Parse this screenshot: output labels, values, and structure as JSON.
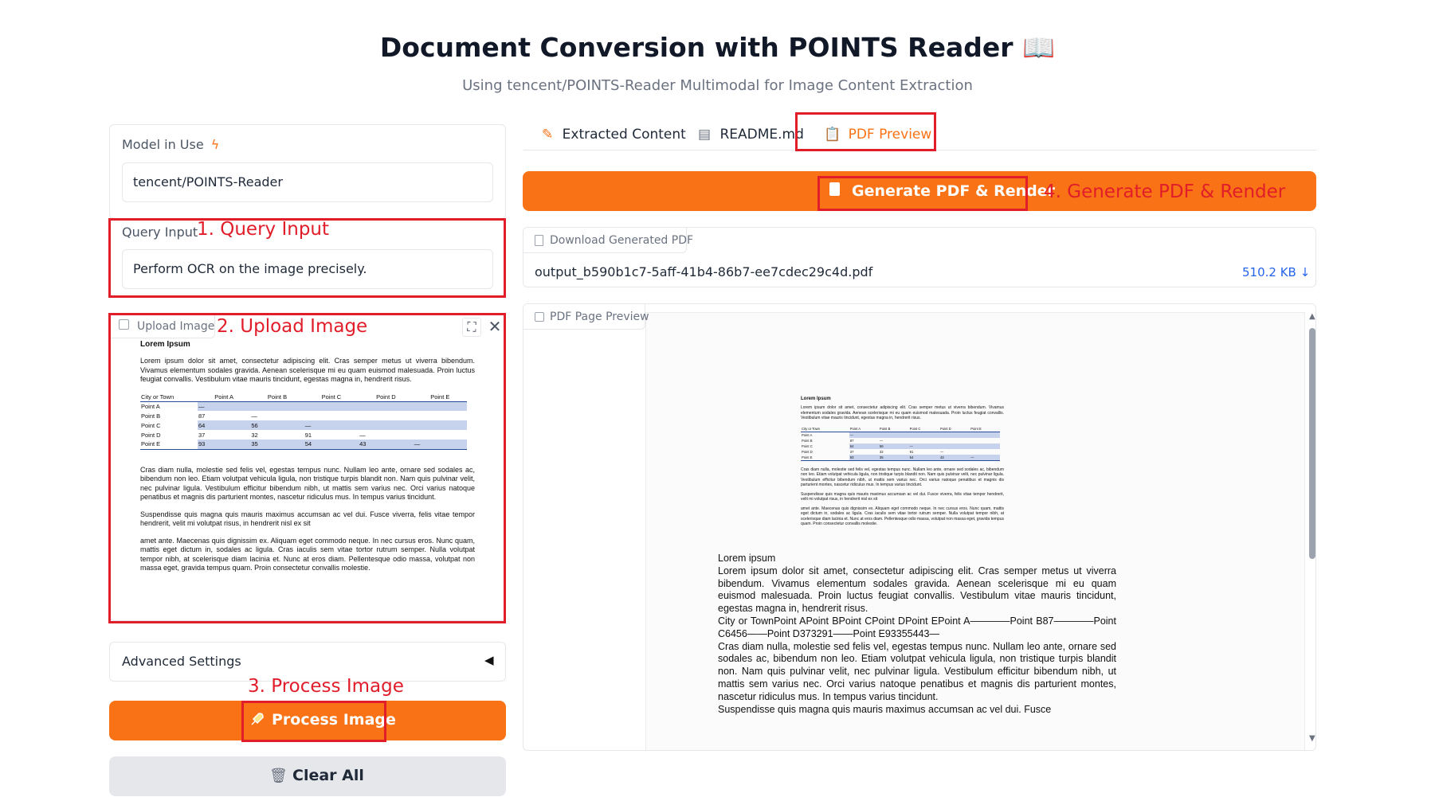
{
  "header": {
    "title": "Document Conversion with POINTS Reader 📖",
    "subtitle": "Using tencent/POINTS-Reader Multimodal for Image Content Extraction"
  },
  "left": {
    "model_label": "Model in Use",
    "model_value": "tencent/POINTS-Reader",
    "query_label": "Query Input",
    "query_value": "Perform OCR on the image precisely.",
    "upload_label": "Upload Image",
    "advanced_label": "Advanced Settings",
    "process_label": "Process Image",
    "clear_label": "Clear All"
  },
  "annotations": {
    "a1": "1. Query Input",
    "a2": "2. Upload Image",
    "a3": "3. Process Image",
    "a4": "4. Generate PDF & Render"
  },
  "tabs": [
    {
      "label": "Extracted Content"
    },
    {
      "label": "README.md"
    },
    {
      "label": "PDF Preview"
    }
  ],
  "right": {
    "generate_label": "Generate PDF & Render",
    "download_label": "Download Generated PDF",
    "file_name": "output_b590b1c7-5aff-41b4-86b7-ee7cdec29c4d.pdf",
    "file_size": "510.2 KB",
    "preview_label": "PDF Page Preview"
  },
  "doc": {
    "heading": "Lorem Ipsum",
    "p1": "Lorem ipsum dolor sit amet, consectetur adipiscing elit. Cras semper metus ut viverra bibendum. Vivamus elementum sodales gravida. Aenean scelerisque mi eu quam euismod malesuada. Proin luctus feugiat convallis. Vestibulum vitae mauris tincidunt, egestas magna in, hendrerit risus.",
    "table_headers": [
      "City or Town",
      "Point A",
      "Point B",
      "Point C",
      "Point D",
      "Point E"
    ],
    "table_rows": [
      [
        "Point A",
        "—",
        "",
        "",
        "",
        ""
      ],
      [
        "Point B",
        "87",
        "—",
        "",
        "",
        ""
      ],
      [
        "Point C",
        "64",
        "56",
        "—",
        "",
        ""
      ],
      [
        "Point D",
        "37",
        "32",
        "91",
        "—",
        ""
      ],
      [
        "Point E",
        "93",
        "35",
        "54",
        "43",
        "—"
      ]
    ],
    "p2": "Cras diam nulla, molestie sed felis vel, egestas tempus nunc. Nullam leo ante, ornare sed sodales ac, bibendum non leo. Etiam volutpat vehicula ligula, non tristique turpis blandit non. Nam quis pulvinar velit, nec pulvinar ligula. Vestibulum efficitur bibendum nibh, ut mattis sem varius nec. Orci varius natoque penatibus et magnis dis parturient montes, nascetur ridiculus mus. In tempus varius tincidunt.",
    "p3": "Suspendisse quis magna quis mauris maximus accumsan ac vel dui. Fusce viverra, felis vitae tempor hendrerit, velit mi volutpat risus, in hendrerit nisl ex sit",
    "p4": "amet ante. Maecenas quis dignissim ex. Aliquam eget commodo neque. In nec cursus eros. Nunc quam, mattis eget dictum in, sodales ac ligula. Cras iaculis sem vitae tortor rutrum semper. Nulla volutpat tempor nibh, at scelerisque diam lacinia et. Nunc at eros diam. Pellentesque odio massa, volutpat non massa eget, gravida tempus quam. Proin consectetur convallis molestie."
  },
  "extracted": {
    "heading": "Lorem ipsum",
    "p1": "Lorem ipsum dolor sit amet, consectetur adipiscing elit. Cras semper metus ut viverra bibendum. Vivamus elementum sodales gravida. Aenean scelerisque mi eu quam euismod malesuada. Proin luctus feugiat convallis. Vestibulum vitae mauris tincidunt, egestas magna in, hendrerit risus.",
    "p2": "City or TownPoint APoint BPoint CPoint DPoint EPoint A————Point B87————Point C6456——Point D373291——Point E93355443—",
    "p3": "Cras diam nulla, molestie sed felis vel, egestas tempus nunc. Nullam leo ante, ornare sed sodales ac, bibendum non leo. Etiam volutpat vehicula ligula, non tristique turpis blandit non. Nam quis pulvinar velit, nec pulvinar ligula. Vestibulum efficitur bibendum nibh, ut mattis sem varius nec. Orci varius natoque penatibus et magnis dis parturient montes, nascetur ridiculus mus. In tempus varius tincidunt.",
    "p4": "Suspendisse quis magna quis mauris maximus accumsan ac vel dui. Fusce"
  }
}
